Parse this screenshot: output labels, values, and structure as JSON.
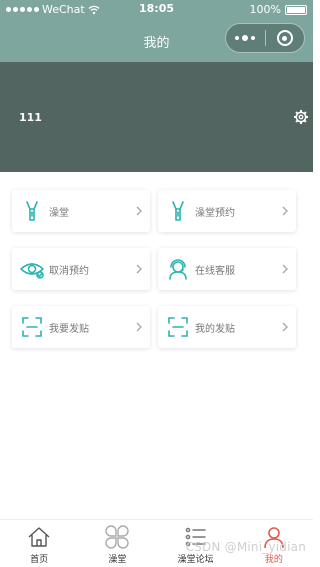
{
  "status_bar": {
    "carrier": "WeChat",
    "time": "18:05",
    "battery": "100%",
    "battery_level": 1.0
  },
  "nav": {
    "title": "我的"
  },
  "profile": {
    "username": "111"
  },
  "menu": [
    {
      "label": "澡堂",
      "icon": "shower-icon"
    },
    {
      "label": "澡堂预约",
      "icon": "shower-icon"
    },
    {
      "label": "取消预约",
      "icon": "eye-icon"
    },
    {
      "label": "在线客服",
      "icon": "support-agent-icon"
    },
    {
      "label": "我要发贴",
      "icon": "scan-frame-icon"
    },
    {
      "label": "我的发贴",
      "icon": "scan-frame-icon"
    }
  ],
  "tabs": [
    {
      "label": "首页",
      "icon": "home-icon"
    },
    {
      "label": "澡堂",
      "icon": "grid-clover-icon"
    },
    {
      "label": "澡堂论坛",
      "icon": "list-icon"
    },
    {
      "label": "我的",
      "icon": "user-icon",
      "active": true
    }
  ],
  "watermark": "CSDN @Mini_yidian",
  "colors": {
    "header_bg": "#7ea69e",
    "banner_bg": "#536560",
    "icon_teal": "#2cb4b0",
    "active_tab": "#e55a4b"
  }
}
